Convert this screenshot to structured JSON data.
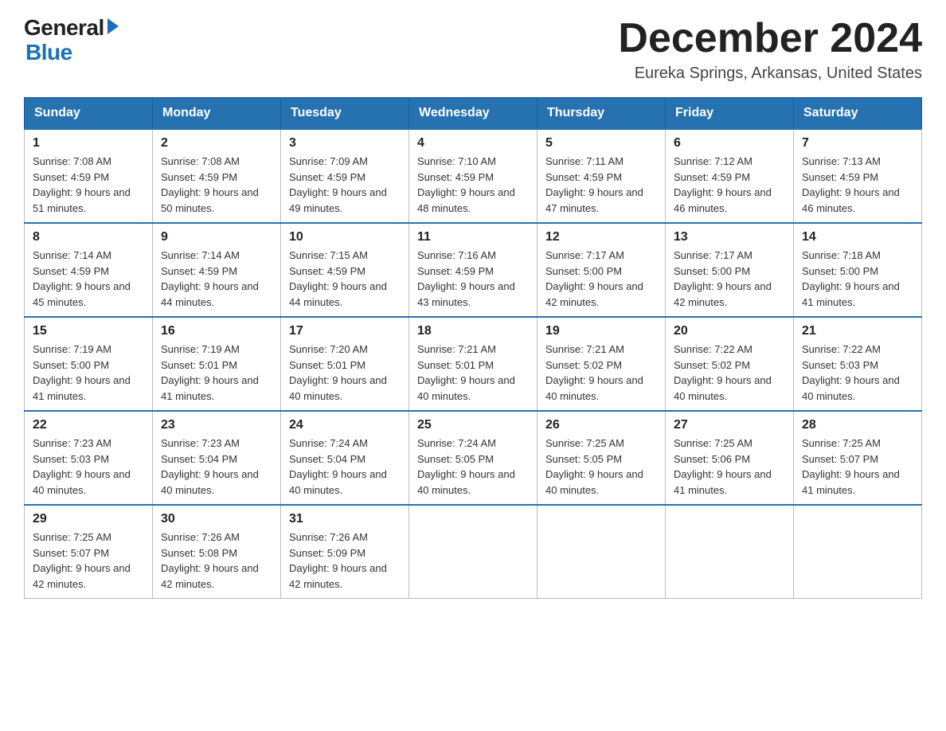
{
  "header": {
    "logo_general": "General",
    "logo_blue": "Blue",
    "month_title": "December 2024",
    "location": "Eureka Springs, Arkansas, United States"
  },
  "weekdays": [
    "Sunday",
    "Monday",
    "Tuesday",
    "Wednesday",
    "Thursday",
    "Friday",
    "Saturday"
  ],
  "weeks": [
    [
      {
        "day": "1",
        "sunrise": "7:08 AM",
        "sunset": "4:59 PM",
        "daylight": "9 hours and 51 minutes."
      },
      {
        "day": "2",
        "sunrise": "7:08 AM",
        "sunset": "4:59 PM",
        "daylight": "9 hours and 50 minutes."
      },
      {
        "day": "3",
        "sunrise": "7:09 AM",
        "sunset": "4:59 PM",
        "daylight": "9 hours and 49 minutes."
      },
      {
        "day": "4",
        "sunrise": "7:10 AM",
        "sunset": "4:59 PM",
        "daylight": "9 hours and 48 minutes."
      },
      {
        "day": "5",
        "sunrise": "7:11 AM",
        "sunset": "4:59 PM",
        "daylight": "9 hours and 47 minutes."
      },
      {
        "day": "6",
        "sunrise": "7:12 AM",
        "sunset": "4:59 PM",
        "daylight": "9 hours and 46 minutes."
      },
      {
        "day": "7",
        "sunrise": "7:13 AM",
        "sunset": "4:59 PM",
        "daylight": "9 hours and 46 minutes."
      }
    ],
    [
      {
        "day": "8",
        "sunrise": "7:14 AM",
        "sunset": "4:59 PM",
        "daylight": "9 hours and 45 minutes."
      },
      {
        "day": "9",
        "sunrise": "7:14 AM",
        "sunset": "4:59 PM",
        "daylight": "9 hours and 44 minutes."
      },
      {
        "day": "10",
        "sunrise": "7:15 AM",
        "sunset": "4:59 PM",
        "daylight": "9 hours and 44 minutes."
      },
      {
        "day": "11",
        "sunrise": "7:16 AM",
        "sunset": "4:59 PM",
        "daylight": "9 hours and 43 minutes."
      },
      {
        "day": "12",
        "sunrise": "7:17 AM",
        "sunset": "5:00 PM",
        "daylight": "9 hours and 42 minutes."
      },
      {
        "day": "13",
        "sunrise": "7:17 AM",
        "sunset": "5:00 PM",
        "daylight": "9 hours and 42 minutes."
      },
      {
        "day": "14",
        "sunrise": "7:18 AM",
        "sunset": "5:00 PM",
        "daylight": "9 hours and 41 minutes."
      }
    ],
    [
      {
        "day": "15",
        "sunrise": "7:19 AM",
        "sunset": "5:00 PM",
        "daylight": "9 hours and 41 minutes."
      },
      {
        "day": "16",
        "sunrise": "7:19 AM",
        "sunset": "5:01 PM",
        "daylight": "9 hours and 41 minutes."
      },
      {
        "day": "17",
        "sunrise": "7:20 AM",
        "sunset": "5:01 PM",
        "daylight": "9 hours and 40 minutes."
      },
      {
        "day": "18",
        "sunrise": "7:21 AM",
        "sunset": "5:01 PM",
        "daylight": "9 hours and 40 minutes."
      },
      {
        "day": "19",
        "sunrise": "7:21 AM",
        "sunset": "5:02 PM",
        "daylight": "9 hours and 40 minutes."
      },
      {
        "day": "20",
        "sunrise": "7:22 AM",
        "sunset": "5:02 PM",
        "daylight": "9 hours and 40 minutes."
      },
      {
        "day": "21",
        "sunrise": "7:22 AM",
        "sunset": "5:03 PM",
        "daylight": "9 hours and 40 minutes."
      }
    ],
    [
      {
        "day": "22",
        "sunrise": "7:23 AM",
        "sunset": "5:03 PM",
        "daylight": "9 hours and 40 minutes."
      },
      {
        "day": "23",
        "sunrise": "7:23 AM",
        "sunset": "5:04 PM",
        "daylight": "9 hours and 40 minutes."
      },
      {
        "day": "24",
        "sunrise": "7:24 AM",
        "sunset": "5:04 PM",
        "daylight": "9 hours and 40 minutes."
      },
      {
        "day": "25",
        "sunrise": "7:24 AM",
        "sunset": "5:05 PM",
        "daylight": "9 hours and 40 minutes."
      },
      {
        "day": "26",
        "sunrise": "7:25 AM",
        "sunset": "5:05 PM",
        "daylight": "9 hours and 40 minutes."
      },
      {
        "day": "27",
        "sunrise": "7:25 AM",
        "sunset": "5:06 PM",
        "daylight": "9 hours and 41 minutes."
      },
      {
        "day": "28",
        "sunrise": "7:25 AM",
        "sunset": "5:07 PM",
        "daylight": "9 hours and 41 minutes."
      }
    ],
    [
      {
        "day": "29",
        "sunrise": "7:25 AM",
        "sunset": "5:07 PM",
        "daylight": "9 hours and 42 minutes."
      },
      {
        "day": "30",
        "sunrise": "7:26 AM",
        "sunset": "5:08 PM",
        "daylight": "9 hours and 42 minutes."
      },
      {
        "day": "31",
        "sunrise": "7:26 AM",
        "sunset": "5:09 PM",
        "daylight": "9 hours and 42 minutes."
      },
      null,
      null,
      null,
      null
    ]
  ]
}
